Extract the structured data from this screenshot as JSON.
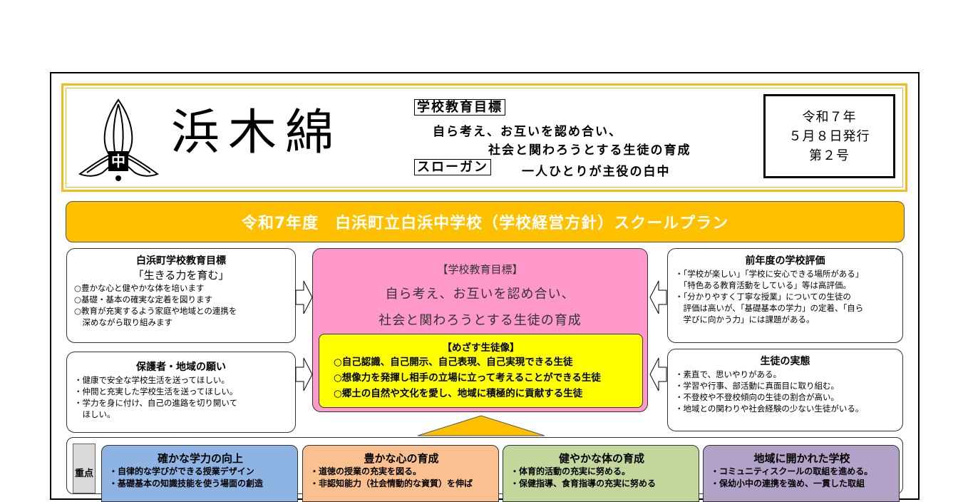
{
  "masthead": {
    "title": "浜木綿",
    "logo_icon": "school-crest-icon",
    "goal_label": "学校教育目標",
    "goal_line1": "自ら考え、お互いを認め合い、",
    "goal_line2": "社会と関わろうとする生徒の育成",
    "slogan_label": "スローガン",
    "slogan_text": "一人ひとりが主役の白中",
    "issue": [
      "令和７年",
      "５月８日発行",
      "第２号"
    ]
  },
  "banner": {
    "text": "令和7年度　白浜町立白浜中学校（学校経営方針）スクールプラン",
    "color": "#ffc000"
  },
  "town_goal": {
    "heading": "白浜町学校教育目標",
    "subheading": "「生きる力を育む」",
    "items": [
      "○豊かな心と健やかな体を培います",
      "○基礎・基本の確実な定着を図ります",
      "○教育が充実するよう家庭や地域との連携を",
      "　深めながら取り組みます"
    ]
  },
  "parents": {
    "heading": "保護者・地域の願い",
    "items": [
      "・健康で安全な学校生活を送ってほしい。",
      "・仲間と充実した学校生活を送ってほしい。",
      "・学力を身に付け、自己の進路を切り開いて",
      "　ほしい。"
    ]
  },
  "evaluation": {
    "heading": "前年度の学校評価",
    "items": [
      "・「学校が楽しい」「学校に安心できる場所がある」",
      "　「特色ある教育活動をしている」等は高評価。",
      "・「分かりやすく丁寧な授業」についての生徒の",
      "　評価は高いが、「基礎基本の学力」の定着、「自ら",
      "　学びに向かう力」には課題がある。"
    ]
  },
  "students": {
    "heading": "生徒の実態",
    "items": [
      "・素直で、思いやりがある。",
      "・学習や行事、部活動に真面目に取り組む。",
      "・不登校や不登校傾向の生徒の割合が高い。",
      "・地域との関わりや社会経験の少ない生徒がいる。"
    ]
  },
  "center": {
    "heading": "【学校教育目標】",
    "line1": "自ら考え、お互いを認め合い、",
    "line2": "社会と関わろうとする生徒の育成",
    "ideal_heading": "【めざす生徒像】",
    "ideal_items": [
      "○自己認識、自己開示、自己表現、自己実現できる生徒",
      "○想像力を発揮し相手の立場に立って考えることができる生徒",
      "○郷土の自然や文化を愛し、地域に積極的に貢献する生徒"
    ],
    "color": "#ff99cc"
  },
  "focus": {
    "label": "重点",
    "pillars": [
      {
        "heading": "確かな学力の向上",
        "items": [
          "・自律的な学びができる授業デザイン",
          "・基礎基本の知識技能を使う場面の創造"
        ],
        "color": "#8eb4e3"
      },
      {
        "heading": "豊かな心の育成",
        "items": [
          "・道徳の授業の充実を図る。",
          "・非認知能力（社会情動的な資質）を伸ば"
        ],
        "color": "#fac090"
      },
      {
        "heading": "健やかな体の育成",
        "items": [
          "・体育的活動の充実に努める。",
          "・保健指導、食育指導の充実に努める"
        ],
        "color": "#c3d69b"
      },
      {
        "heading": "地域に開かれた学校",
        "items": [
          "・コミュニティスクールの取組を進める。",
          "・保幼小中の連携を強め、一貫した取組"
        ],
        "color": "#b3a2c7"
      }
    ]
  }
}
